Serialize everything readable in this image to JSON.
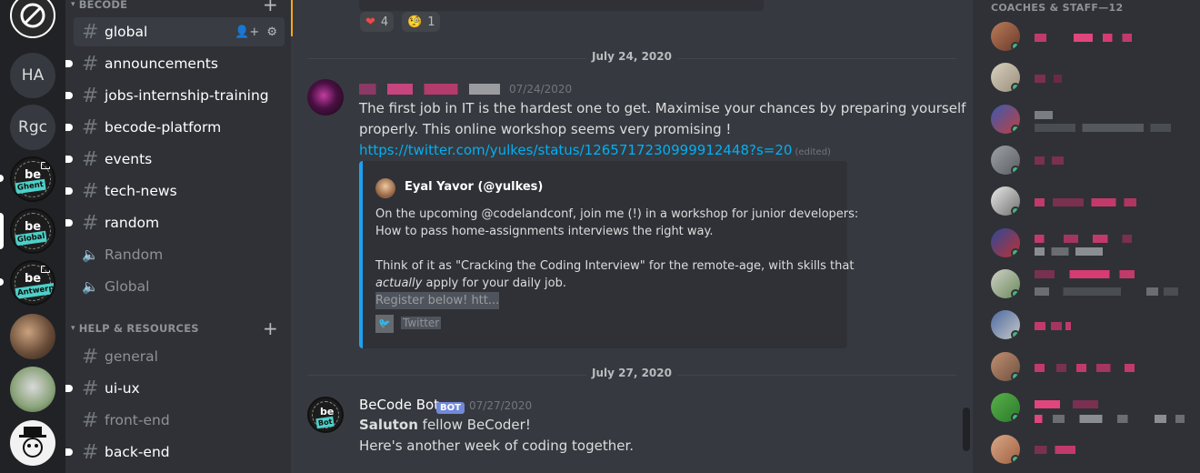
{
  "servers": {
    "items": [
      {
        "label": "HA"
      },
      {
        "label": "Rgc"
      },
      {
        "be": "be",
        "tag": "Ghent"
      },
      {
        "be": "be",
        "tag": "Global"
      },
      {
        "be": "be",
        "tag": "Antwerpen"
      }
    ]
  },
  "sidebar": {
    "category_becode": "BECODE",
    "category_help": "HELP & RESOURCES",
    "channels": [
      {
        "name": "global"
      },
      {
        "name": "announcements"
      },
      {
        "name": "jobs-internship-training"
      },
      {
        "name": "becode-platform"
      },
      {
        "name": "events"
      },
      {
        "name": "tech-news"
      },
      {
        "name": "random"
      },
      {
        "name": "Random"
      },
      {
        "name": "Global"
      }
    ],
    "help_channels": [
      {
        "name": "general"
      },
      {
        "name": "ui-ux"
      },
      {
        "name": "front-end"
      },
      {
        "name": "back-end"
      }
    ]
  },
  "chat": {
    "reactions": [
      {
        "emoji": "❤",
        "count": "4"
      },
      {
        "emoji": "🧐",
        "count": "1"
      }
    ],
    "date1": "July 24, 2020",
    "msg1": {
      "timestamp": "07/24/2020",
      "line1": "The first job in IT is the hardest one to get. Maximise your chances by preparing yourself",
      "line2": "properly. This online workshop seems very promising !",
      "link": "https://twitter.com/yulkes/status/1265717230999912448?s=20",
      "edited": "(edited)"
    },
    "embed": {
      "author": "Eyal Yavor (@yulkes)",
      "line1": "On the upcoming @codelandconf, join me (!) in a workshop for junior developers:",
      "line2": "How to pass home-assignments interviews the right way.",
      "line3": "Think of it as \"Cracking the Coding Interview\" for the remote-age, with skills that",
      "line4_em": "actually",
      "line4_rest": " apply for your daily job.",
      "line5": "Register below! htt...",
      "footer": "Twitter"
    },
    "date2": "July 27, 2020",
    "msg2": {
      "author": "BeCode Bot",
      "badge": "BOT",
      "timestamp": "07/27/2020",
      "line1_bold": "Saluton",
      "line1_rest": " fellow BeCoder!",
      "line2": "Here's another week of coding together.",
      "avatar_be": "be",
      "avatar_tag": "Bot"
    }
  },
  "members": {
    "category": "COACHES & STAFF—12"
  }
}
